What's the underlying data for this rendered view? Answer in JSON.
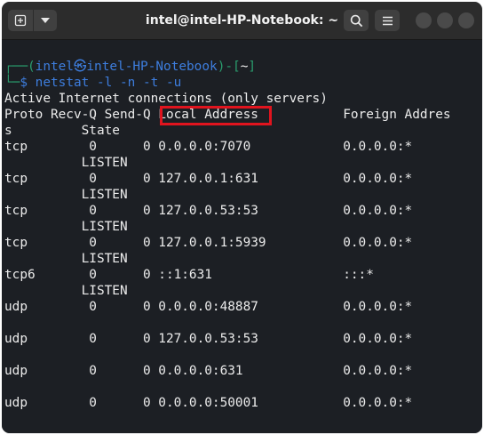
{
  "window": {
    "title": "intel@intel-HP-Notebook: ~",
    "new_tab_icon": "plus-icon",
    "dropdown_icon": "chevron-down-icon",
    "search_icon": "search-icon",
    "menu_icon": "hamburger-icon"
  },
  "prompt": {
    "open": "┌──(",
    "user": "intel",
    "symbol": "㉿",
    "host": "intel-HP-Notebook",
    "dir_open": ")-[",
    "dir": "~",
    "dir_close": "]",
    "second": "└─",
    "dollar": "$",
    "command": "netstat -l -n -t -u"
  },
  "output": {
    "heading": "Active Internet connections (only servers)",
    "header_line1_a": "Proto Recv-Q Send-Q ",
    "header_local": "Local Address",
    "header_line1_b": "           Foreign Addres",
    "header_line2": "s         State",
    "rows": [
      {
        "line": "tcp        0      0 0.0.0.0:7070            0.0.0.0:*",
        "state": "          LISTEN"
      },
      {
        "line": "tcp        0      0 127.0.0.1:631           0.0.0.0:*",
        "state": "          LISTEN"
      },
      {
        "line": "tcp        0      0 127.0.0.53:53           0.0.0.0:*",
        "state": "          LISTEN"
      },
      {
        "line": "tcp        0      0 127.0.0.1:5939          0.0.0.0:*",
        "state": "          LISTEN"
      },
      {
        "line": "tcp6       0      0 ::1:631                 :::*",
        "state": "          LISTEN"
      },
      {
        "line": "udp        0      0 0.0.0.0:48887           0.0.0.0:*",
        "state": ""
      },
      {
        "line": "udp        0      0 127.0.0.53:53           0.0.0.0:*",
        "state": ""
      },
      {
        "line": "udp        0      0 0.0.0.0:631             0.0.0.0:*",
        "state": ""
      },
      {
        "line": "udp        0      0 0.0.0.0:50001           0.0.0.0:*",
        "state": ""
      }
    ]
  },
  "colors": {
    "highlight_box": "#e0141e",
    "prompt_green": "#2a9d6e",
    "prompt_blue": "#3d7ddd"
  }
}
